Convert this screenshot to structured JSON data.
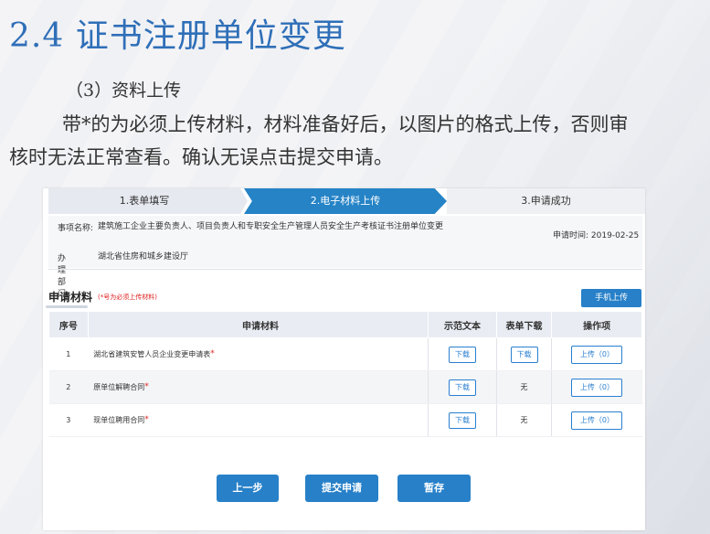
{
  "slide": {
    "title": "2.4 证书注册单位变更",
    "subtitle": "（3）资料上传",
    "body": "带*的为必须上传材料，材料准备好后，以图片的格式上传，否则审核时无法正常查看。确认无误点击提交申请。"
  },
  "steps": [
    "1.表单填写",
    "2.电子材料上传",
    "3.申请成功"
  ],
  "info": {
    "item_key": "事项名称:",
    "item_value": "建筑施工企业主要负责人、项目负责人和专职安全生产管理人员安全生产考核证书注册单位变更",
    "time_label": "申请时间:",
    "time_value": "2019-02-25",
    "dept_key": "办理部门:",
    "dept_value": "湖北省住房和城乡建设厅"
  },
  "materials": {
    "heading": "申请材料",
    "note": "(*号为必须上传材料)",
    "upload_button": "手机上传",
    "columns": [
      "序号",
      "申请材料",
      "示范文本",
      "表单下载",
      "操作项"
    ],
    "rows": [
      {
        "no": "1",
        "name": "湖北省建筑安管人员企业变更申请表",
        "example": "下载",
        "form": "下载",
        "op": "上传（0）"
      },
      {
        "no": "2",
        "name": "原单位解聘合同",
        "example": "下载",
        "form": "无",
        "op": "上传（0）"
      },
      {
        "no": "3",
        "name": "现单位聘用合同",
        "example": "下载",
        "form": "无",
        "op": "上传（0）"
      }
    ],
    "required_mark": "*"
  },
  "buttons": {
    "prev": "上一步",
    "submit": "提交申请",
    "save": "暂存"
  },
  "colors": {
    "accent": "#2780c8",
    "title": "#2f6fb8",
    "required": "#e02020"
  }
}
